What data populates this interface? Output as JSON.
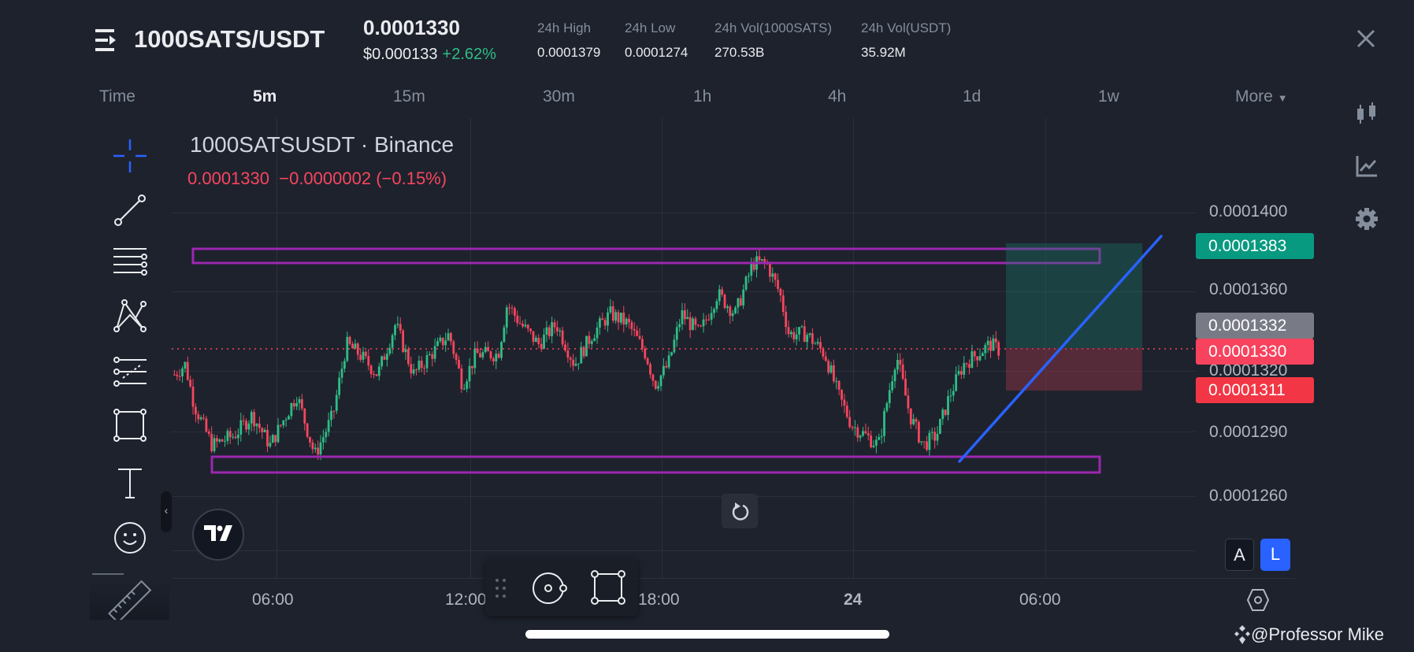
{
  "header": {
    "symbol": "1000SATS/USDT",
    "last_price": "0.0001330",
    "usd_price": "$0.000133",
    "change_pct": "+2.62%",
    "stats": [
      {
        "label": "24h High",
        "value": "0.0001379"
      },
      {
        "label": "24h Low",
        "value": "0.0001274"
      },
      {
        "label": "24h Vol(1000SATS)",
        "value": "270.53B"
      },
      {
        "label": "24h Vol(USDT)",
        "value": "35.92M"
      }
    ]
  },
  "timeframes": {
    "time_label": "Time",
    "items": [
      "5m",
      "15m",
      "30m",
      "1h",
      "4h",
      "1d",
      "1w"
    ],
    "active": "5m",
    "more_label": "More"
  },
  "chart": {
    "title": "1000SATSUSDT · Binance",
    "ohlc_price": "0.0001330",
    "ohlc_change": "−0.0000002 (−0.15%)",
    "price_ticks": [
      "0.0001400",
      "0.0001360",
      "0.0001320",
      "0.0001290",
      "0.0001260"
    ],
    "time_ticks": [
      "06:00",
      "12:00",
      "18:00",
      "24",
      "06:00"
    ],
    "badges": {
      "target": "0.0001383",
      "crosshair": "0.0001332",
      "last": "0.0001330",
      "stop": "0.0001311"
    },
    "scale_buttons": {
      "auto": "A",
      "log": "L"
    },
    "colors": {
      "up": "#2ebd85",
      "down": "#f6465d",
      "zone": "#9c27b0",
      "trend": "#2962ff"
    },
    "price_path": [
      [
        2.8,
        1320
      ],
      [
        3.14,
        1325
      ],
      [
        3.42,
        1305
      ],
      [
        3.98,
        1285
      ],
      [
        4.68,
        1290
      ],
      [
        5.24,
        1300
      ],
      [
        5.8,
        1285
      ],
      [
        6.64,
        1310
      ],
      [
        7.2,
        1280
      ],
      [
        7.77,
        1300
      ],
      [
        8.19,
        1335
      ],
      [
        8.6,
        1330
      ],
      [
        9.17,
        1320
      ],
      [
        9.73,
        1345
      ],
      [
        10.29,
        1320
      ],
      [
        10.85,
        1330
      ],
      [
        11.41,
        1340
      ],
      [
        11.83,
        1315
      ],
      [
        12.25,
        1330
      ],
      [
        12.95,
        1330
      ],
      [
        13.23,
        1355
      ],
      [
        13.65,
        1345
      ],
      [
        14.21,
        1335
      ],
      [
        14.77,
        1345
      ],
      [
        15.34,
        1325
      ],
      [
        15.9,
        1340
      ],
      [
        16.46,
        1350
      ],
      [
        17.02,
        1345
      ],
      [
        17.58,
        1330
      ],
      [
        17.86,
        1315
      ],
      [
        18.28,
        1325
      ],
      [
        18.7,
        1350
      ],
      [
        19.26,
        1340
      ],
      [
        19.82,
        1360
      ],
      [
        20.38,
        1350
      ],
      [
        20.94,
        1375
      ],
      [
        21.36,
        1375
      ],
      [
        21.78,
        1360
      ],
      [
        22.06,
        1340
      ],
      [
        22.62,
        1340
      ],
      [
        23.19,
        1330
      ],
      [
        23.61,
        1310
      ],
      [
        24.03,
        1295
      ],
      [
        24.45,
        1290
      ],
      [
        24.87,
        1285
      ],
      [
        25.43,
        1330
      ],
      [
        25.85,
        1300
      ],
      [
        26.27,
        1285
      ],
      [
        26.69,
        1290
      ],
      [
        27.11,
        1310
      ],
      [
        27.53,
        1325
      ],
      [
        27.95,
        1330
      ],
      [
        28.37,
        1335
      ],
      [
        28.65,
        1332
      ]
    ]
  },
  "watermark": "@Professor Mike"
}
